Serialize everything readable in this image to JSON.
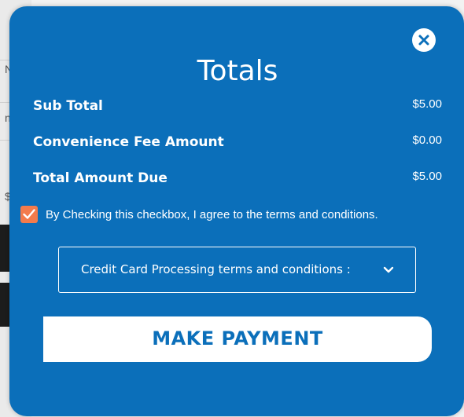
{
  "background_page": {
    "visible_chars": [
      "N",
      "n",
      "$"
    ]
  },
  "modal": {
    "title": "Totals",
    "close_icon": "close-icon",
    "rows": [
      {
        "label": "Sub Total",
        "value": "$5.00"
      },
      {
        "label": "Convenience Fee Amount",
        "value": "$0.00"
      },
      {
        "label": "Total Amount Due",
        "value": "$5.00"
      }
    ],
    "agree": {
      "checked": true,
      "text": "By Checking this checkbox, I agree to the terms and conditions."
    },
    "terms_select": {
      "label": "Credit Card Processing terms and conditions :",
      "icon": "chevron-down-icon"
    },
    "pay_button": {
      "label": "MAKE PAYMENT"
    },
    "colors": {
      "modal_bg": "#0b6fba",
      "checkbox": "#f37b4c",
      "button_text": "#0b6fba"
    }
  }
}
